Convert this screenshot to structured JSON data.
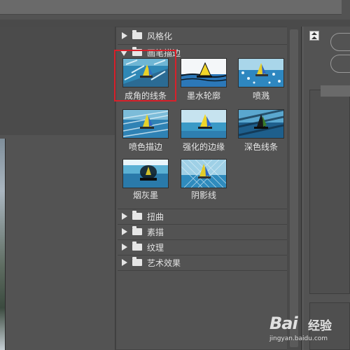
{
  "gallery": {
    "categories_top": [
      {
        "label": "风格化",
        "state": "collapsed"
      },
      {
        "label": "画笔描边",
        "state": "expanded"
      }
    ],
    "filters": [
      {
        "label": "成角的线条",
        "icon": "sailboat-angled-strokes",
        "selected": true
      },
      {
        "label": "墨水轮廓",
        "icon": "sailboat-ink-outlines",
        "selected": false
      },
      {
        "label": "喷溅",
        "icon": "sailboat-spatter",
        "selected": false
      },
      {
        "label": "喷色描边",
        "icon": "sailboat-sprayed-strokes",
        "selected": false
      },
      {
        "label": "强化的边缘",
        "icon": "sailboat-accented-edges",
        "selected": false
      },
      {
        "label": "深色线条",
        "icon": "sailboat-dark-strokes",
        "selected": false
      },
      {
        "label": "烟灰墨",
        "icon": "sailboat-sumi-e",
        "selected": false
      },
      {
        "label": "阴影线",
        "icon": "sailboat-crosshatch",
        "selected": false
      }
    ],
    "categories_bottom": [
      {
        "label": "扭曲",
        "state": "collapsed"
      },
      {
        "label": "素描",
        "state": "collapsed"
      },
      {
        "label": "纹理",
        "state": "collapsed"
      },
      {
        "label": "艺术效果",
        "state": "collapsed"
      }
    ]
  },
  "watermark": {
    "logo": "Bai",
    "logo_cn": "经验",
    "url": "jingyan.baidu.com"
  },
  "colors": {
    "highlight": "#d8202a",
    "panel": "#535353",
    "background": "#3d3d3d"
  }
}
